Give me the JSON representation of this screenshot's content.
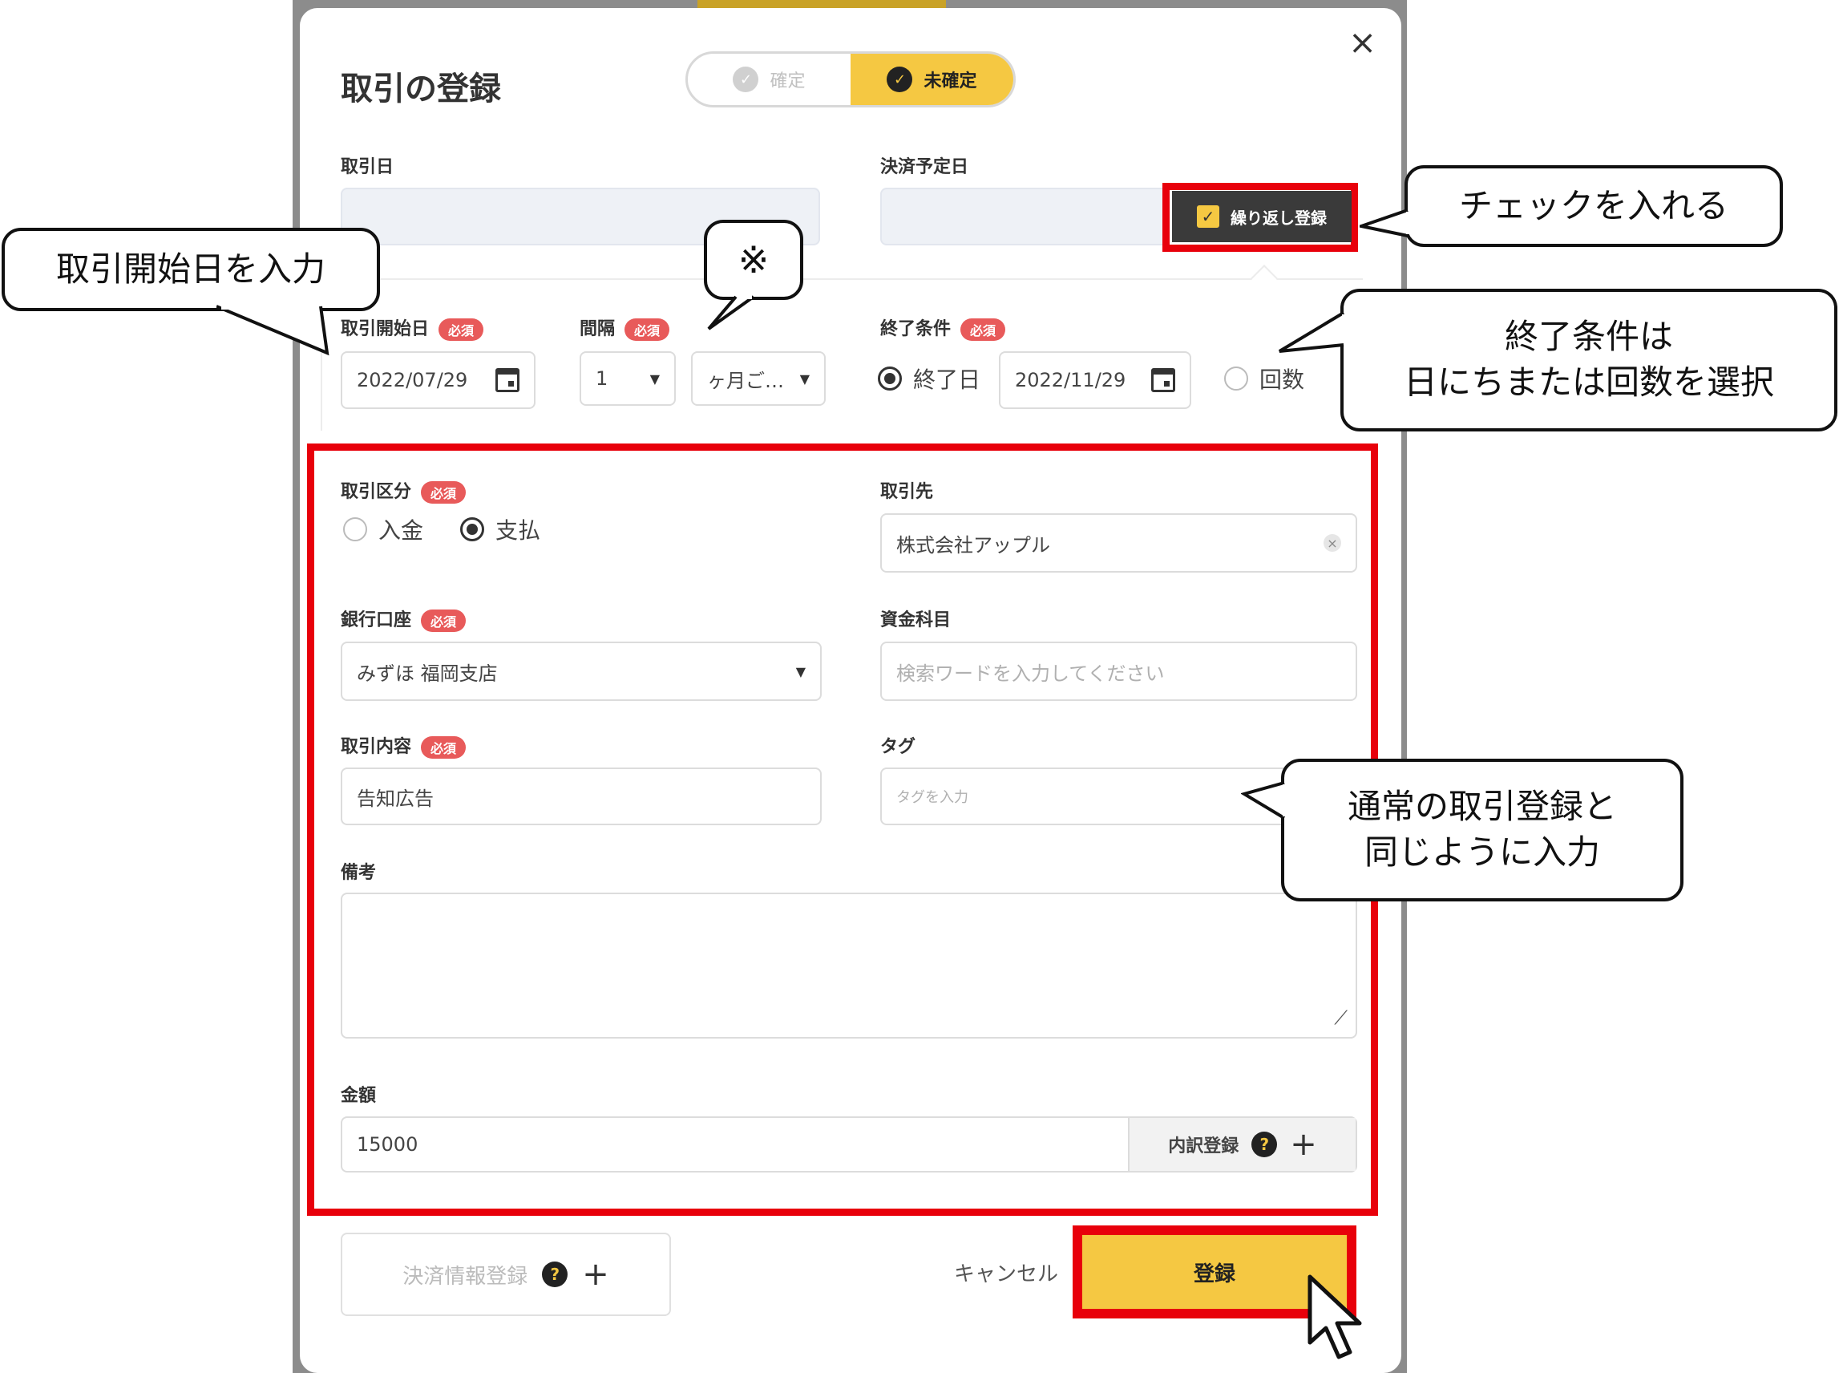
{
  "dialog": {
    "title": "取引の登録",
    "close_icon": "×",
    "toggle": {
      "confirmed": "確定",
      "unconfirmed": "未確定",
      "selected": "未確定"
    }
  },
  "top_fields": {
    "transaction_date_label": "取引日",
    "settlement_date_label": "決済予定日",
    "repeat_label": "繰り返し登録",
    "repeat_checked": true
  },
  "repeat": {
    "start_label": "取引開始日",
    "start_value": "2022/07/29",
    "interval_label": "間隔",
    "interval_value": "1",
    "interval_unit": "ヶ月ご…",
    "end_label": "終了条件",
    "end_option_date": "終了日",
    "end_date_value": "2022/11/29",
    "end_option_count": "回数",
    "end_selected": "終了日",
    "required_badge": "必須"
  },
  "form": {
    "kind_label": "取引区分",
    "kind_income": "入金",
    "kind_payment": "支払",
    "kind_selected": "支払",
    "partner_label": "取引先",
    "partner_value": "株式会社アップル",
    "bank_label": "銀行口座",
    "bank_value": "みずほ 福岡支店",
    "fund_label": "資金科目",
    "fund_placeholder": "検索ワードを入力してください",
    "content_label": "取引内容",
    "content_value": "告知広告",
    "tag_label": "タグ",
    "tag_placeholder": "タグを入力",
    "note_label": "備考",
    "amount_label": "金額",
    "amount_value": "15000",
    "breakdown_label": "内訳登録"
  },
  "footer": {
    "settlement_info_label": "決済情報登録",
    "cancel_label": "キャンセル",
    "register_label": "登録"
  },
  "callouts": {
    "start_date": "取引開始日を入力",
    "note_mark": "※",
    "check": "チェックを入れる",
    "end_line1": "終了条件は",
    "end_line2": "日にちまたは回数を選択",
    "normal_line1": "通常の取引登録と",
    "normal_line2": "同じように入力"
  },
  "colors": {
    "accent": "#f5c842",
    "highlight": "#e8000b",
    "required": "#e85a5a"
  }
}
